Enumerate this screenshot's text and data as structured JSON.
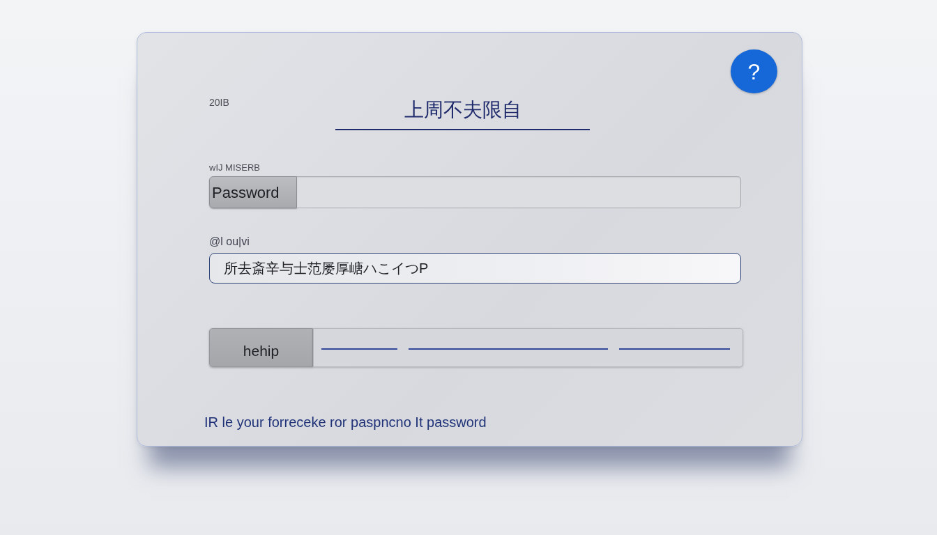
{
  "dialog": {
    "corner_label": "20IB",
    "title": "上周不夫限自",
    "help_button": "?"
  },
  "password_row": {
    "label": "wIJ MISERB",
    "addon": "Password"
  },
  "text_row": {
    "label": "@l ou|vi",
    "value": "所去斎辛与士范屡厚嵣ハこイつP"
  },
  "action_row": {
    "button": "hehip"
  },
  "footer": "IR le your forreceke ror paspncno It password"
}
